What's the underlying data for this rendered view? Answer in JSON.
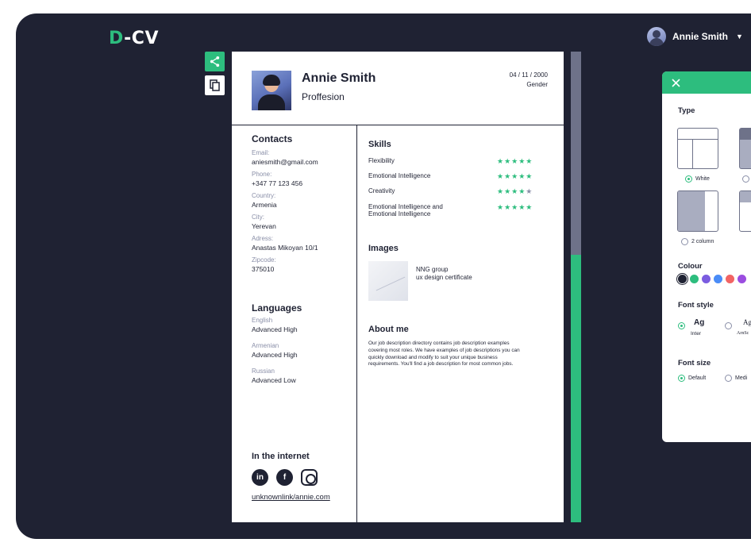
{
  "app": {
    "logo_prefix": "D",
    "logo_suffix": "-CV"
  },
  "user": {
    "name": "Annie Smith"
  },
  "resume": {
    "name": "Annie Smith",
    "profession": "Proffesion",
    "dob": "04 / 11 / 2000",
    "gender": "Gender",
    "contacts": {
      "title": "Contacts",
      "email_label": "Email:",
      "email": "aniesmith@gmail.com",
      "phone_label": "Phone:",
      "phone": "+347 77 123 456",
      "country_label": "Country:",
      "country": "Armenia",
      "city_label": "City:",
      "city": "Yerevan",
      "address_label": "Adress:",
      "address": "Anastas Mikoyan 10/1",
      "zip_label": "Zipcode:",
      "zip": "375010"
    },
    "languages": {
      "title": "Languages",
      "items": [
        {
          "name": "English",
          "level": "Advanced High"
        },
        {
          "name": "Armenian",
          "level": "Advanced High"
        },
        {
          "name": "Russian",
          "level": "Advanced Low"
        }
      ]
    },
    "internet": {
      "title": "In the internet",
      "link": "unknownlink/annie.com"
    },
    "skills": {
      "title": "Skills",
      "items": [
        {
          "name": "Flexibility",
          "rating": 5
        },
        {
          "name": "Emotional Intelligence",
          "rating": 5
        },
        {
          "name": "Creativity",
          "rating": 4
        },
        {
          "name": "Emotional Intelligence and Emotional Intelligence",
          "rating": 5
        }
      ]
    },
    "images": {
      "title": "Images",
      "caption_line1": "NNG group",
      "caption_line2": "ux design certificate"
    },
    "about": {
      "title": "About me",
      "text": "Our job description directory contains job description examples covering most roles. We have examples of job descriptions you can quickly download and modify to suit your unique business requirements. You'll find a job description for most common jobs."
    }
  },
  "panel": {
    "type_title": "Type",
    "type_options": [
      "White",
      "2 column"
    ],
    "colour_title": "Colour",
    "colours": [
      "#1f2233",
      "#2dbd7e",
      "#7b5ce0",
      "#4a8cf7",
      "#f26464",
      "#9b4de0"
    ],
    "font_style_title": "Font style",
    "font_sample": "Ag",
    "font_inter": "Inter",
    "font_second_sample": "Ag",
    "font_second_name": "ArnSc",
    "font_size_title": "Font size",
    "font_size_default": "Default",
    "font_size_medium": "Medi"
  },
  "colors": {
    "accent": "#2dbd7e",
    "dark": "#1f2233",
    "muted": "#6e7289"
  }
}
